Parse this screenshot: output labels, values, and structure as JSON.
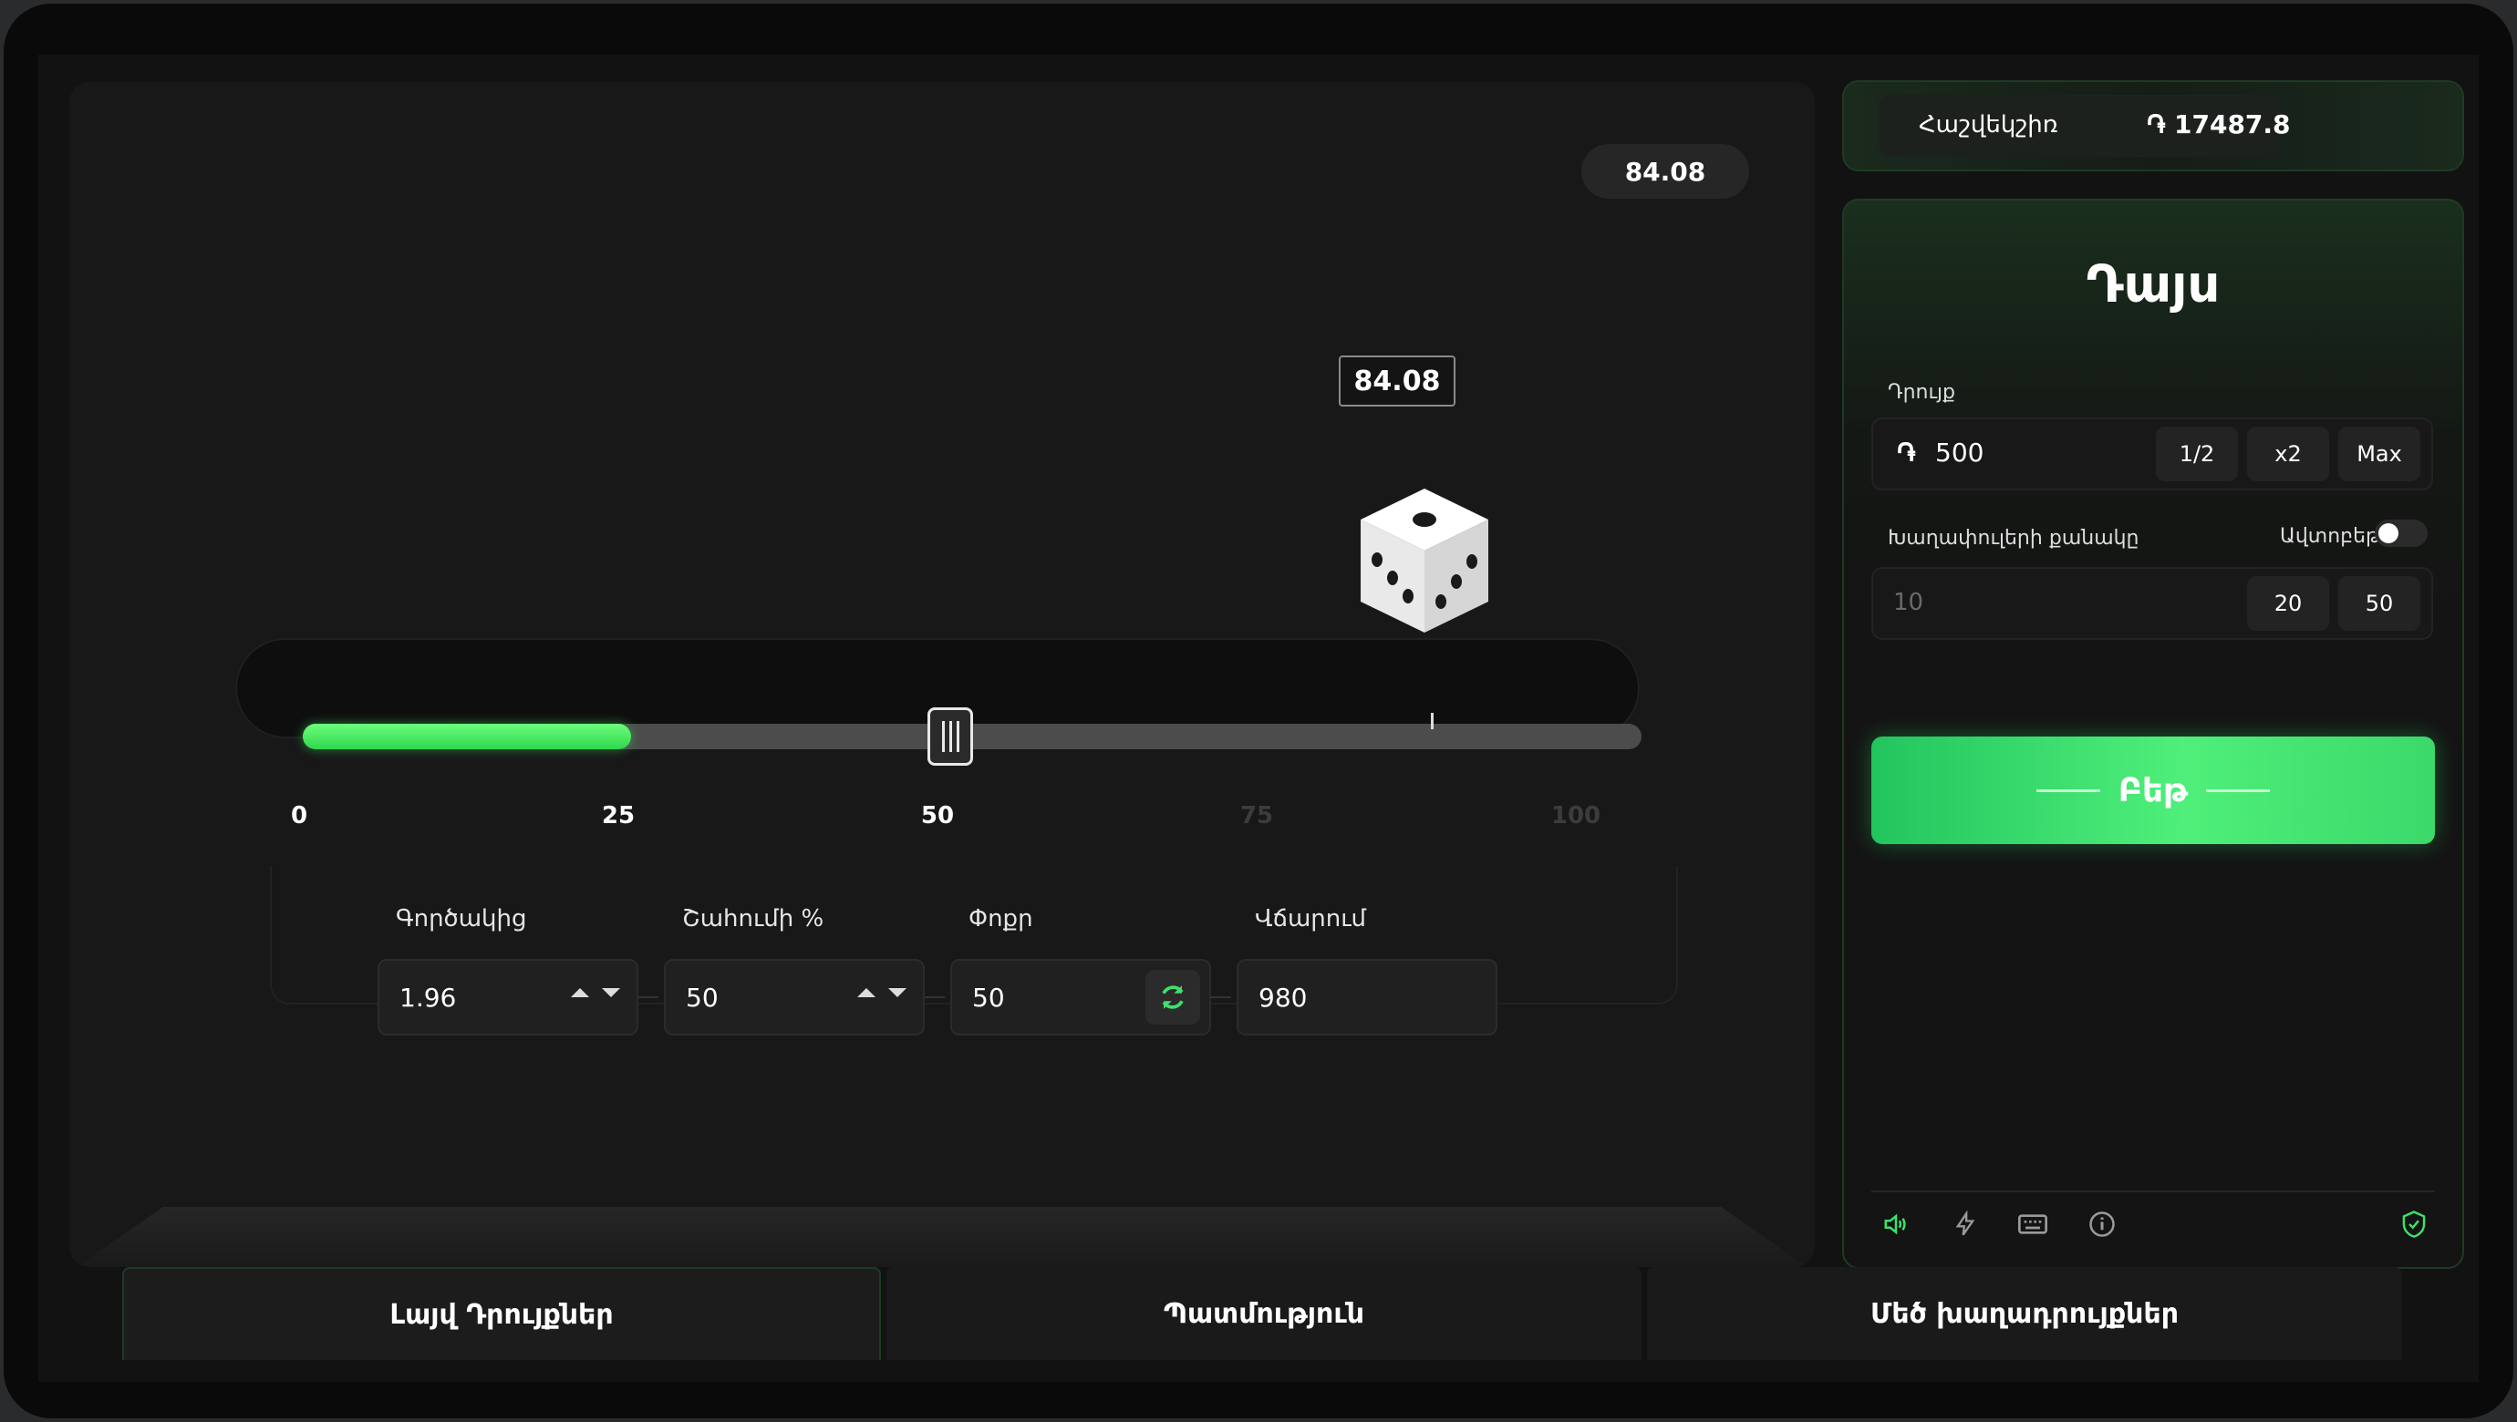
{
  "game": {
    "last_result": "84.08",
    "dice_value": "84.08",
    "slider": {
      "value": 50,
      "result_value": 84.08,
      "ticks": [
        "0",
        "25",
        "50",
        "75",
        "100"
      ]
    },
    "params": {
      "multiplier_label": "Գործակից",
      "multiplier_value": "1.96",
      "win_chance_label": "Շահումի %",
      "win_chance_value": "50",
      "roll_label": "Փոքր",
      "roll_value": "50",
      "payout_label": "Վճարում",
      "payout_value": "980"
    }
  },
  "balance": {
    "label": "Հաշվեկշիռ",
    "currency_symbol": "֏",
    "amount": "17487.8"
  },
  "side": {
    "title": "Դայս",
    "bet_label": "Դրույք",
    "currency_symbol": "֏",
    "bet_value": "500",
    "half_label": "1/2",
    "double_label": "x2",
    "max_label": "Max",
    "autoplay_label": "Խաղափուլերի քանակը",
    "auto_toggle_label": "Ավտոբեթ",
    "rounds_placeholder": "10",
    "rounds_opt1": "20",
    "rounds_opt2": "50",
    "bet_button": "Բեթ"
  },
  "tabs": [
    "Լայվ Դրույքներ",
    "Պատմություն",
    "Մեծ խաղադրույքներ"
  ],
  "colors": {
    "accent": "#3ee06b",
    "background": "#121212"
  }
}
